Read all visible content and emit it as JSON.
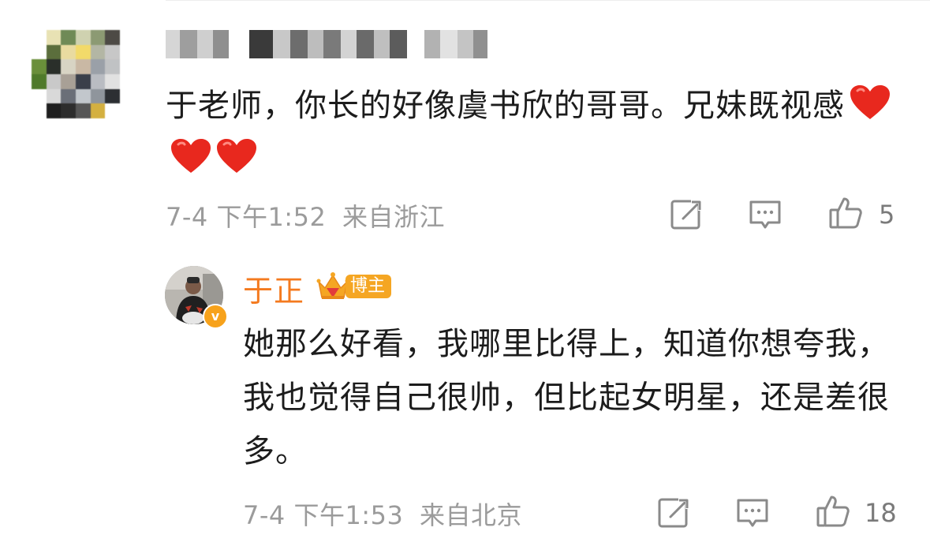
{
  "comment": {
    "text": "于老师，你长的好像虞书欣的哥哥。兄妹既视感",
    "time": "7-4 下午1:52",
    "location": "来自浙江",
    "like_count": "5",
    "reaction": "heart"
  },
  "reply": {
    "username": "于正",
    "badge_label": "博主",
    "verified_mark": "v",
    "text": "她那么好看，我哪里比得上，知道你想夸我，我也觉得自己很帅，但比起女明星，还是差很多。",
    "time": "7-4 下午1:53",
    "location": "来自北京",
    "like_count": "18"
  },
  "icons": [
    "share-icon",
    "comment-icon",
    "like-icon",
    "heart-icon",
    "crown-icon"
  ],
  "colors": {
    "username_orange": "#f47a1f",
    "badge_orange": "#f5a623",
    "meta_gray": "#9b9b9b",
    "heart_red": "#e8281e"
  }
}
